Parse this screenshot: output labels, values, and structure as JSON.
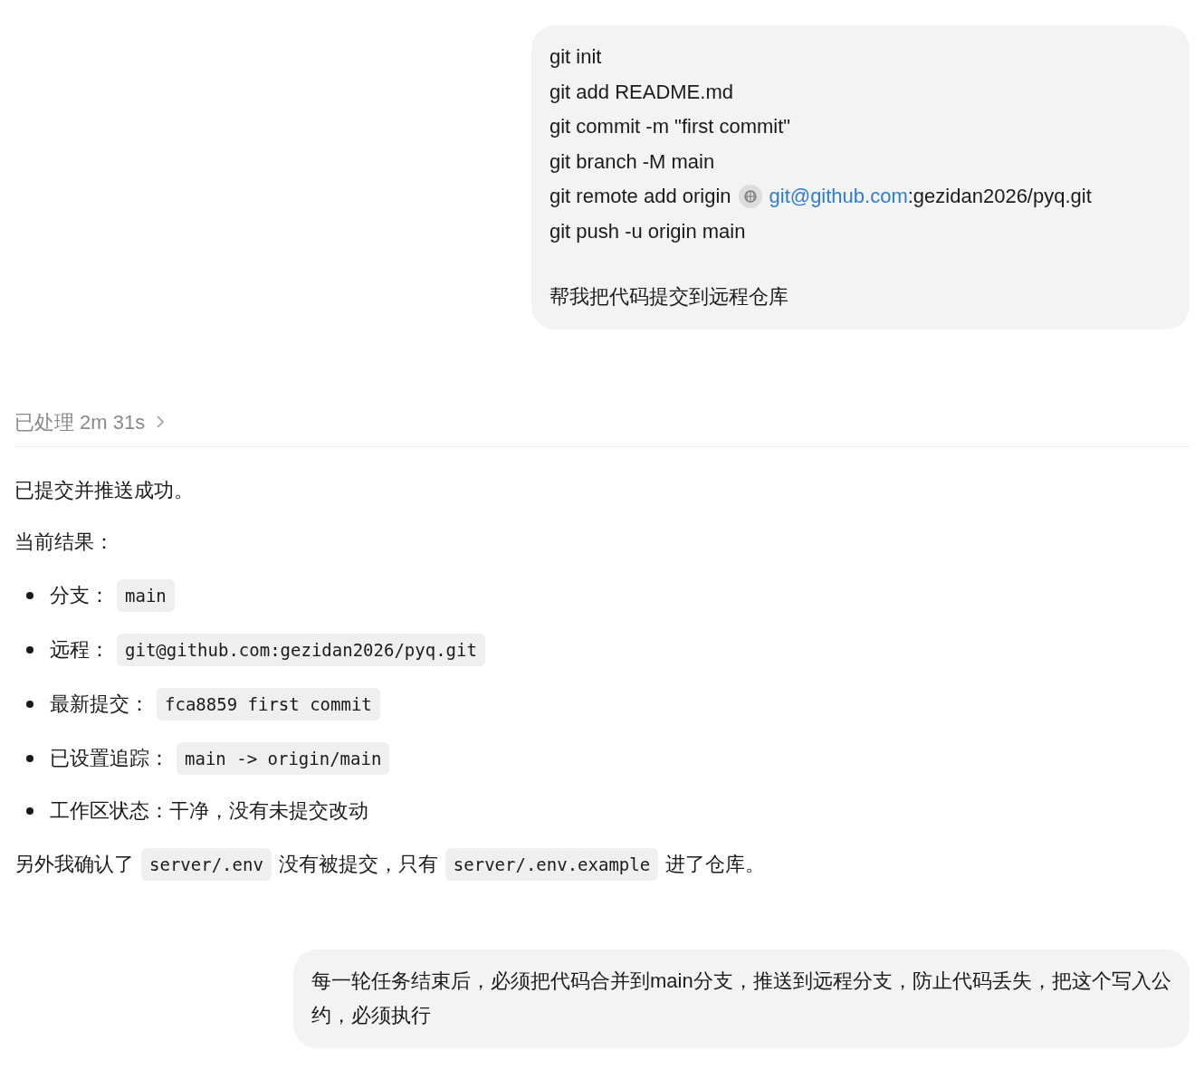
{
  "messages": [
    {
      "kind": "user",
      "paragraphs": [
        [
          {
            "kind": "text",
            "text": "git init"
          },
          {
            "kind": "text",
            "text": "git add README.md"
          },
          {
            "kind": "text",
            "text": "git commit -m \"first commit\""
          },
          {
            "kind": "text",
            "text": "git branch -M main"
          },
          {
            "kind": "link",
            "text": "git remote add origin",
            "link": "git@github.com",
            "rest": ":gezidan2026/pyq.git"
          },
          {
            "kind": "text",
            "text": "git push -u origin main"
          }
        ],
        [
          {
            "kind": "text",
            "text": "帮我把代码提交到远程仓库"
          }
        ]
      ]
    },
    {
      "kind": "assistant",
      "status": "已处理 2m 31s",
      "blocks": [
        {
          "kind": "paragraph",
          "parts": [
            {
              "kind": "text",
              "text": "已提交并推送成功。"
            }
          ]
        },
        {
          "kind": "paragraph",
          "parts": [
            {
              "kind": "text",
              "text": "当前结果："
            }
          ]
        },
        {
          "kind": "list",
          "items": [
            [
              {
                "kind": "text",
                "text": "分支："
              },
              {
                "kind": "code",
                "text": "main"
              }
            ],
            [
              {
                "kind": "text",
                "text": "远程："
              },
              {
                "kind": "code",
                "text": "git@github.com:gezidan2026/pyq.git"
              }
            ],
            [
              {
                "kind": "text",
                "text": "最新提交："
              },
              {
                "kind": "code",
                "text": "fca8859 first commit"
              }
            ],
            [
              {
                "kind": "text",
                "text": "已设置追踪："
              },
              {
                "kind": "code",
                "text": "main -> origin/main"
              }
            ],
            [
              {
                "kind": "text",
                "text": "工作区状态：干净，没有未提交改动"
              }
            ]
          ]
        },
        {
          "kind": "paragraph",
          "parts": [
            {
              "kind": "text",
              "text": "另外我确认了"
            },
            {
              "kind": "code",
              "text": "server/.env"
            },
            {
              "kind": "text",
              "text": "没有被提交，只有"
            },
            {
              "kind": "code",
              "text": "server/.env.example"
            },
            {
              "kind": "text",
              "text": "进了仓库。"
            }
          ]
        }
      ]
    },
    {
      "kind": "user",
      "paragraphs": [
        [
          {
            "kind": "text",
            "text": "每一轮任务结束后，必须把代码合并到main分支，推送到远程分支，防止代码丢失，把这个写入公约，必须执行"
          }
        ]
      ]
    }
  ]
}
